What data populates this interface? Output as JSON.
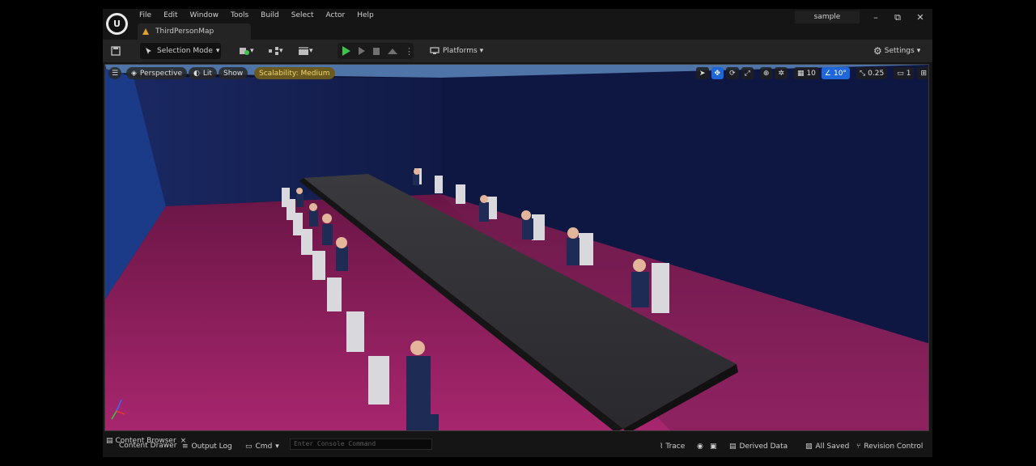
{
  "menu": [
    "File",
    "Edit",
    "Window",
    "Tools",
    "Build",
    "Select",
    "Actor",
    "Help"
  ],
  "tab": {
    "title": "ThirdPersonMap"
  },
  "project": "sample",
  "window_controls": {
    "minimize": "–",
    "restore": "⧉",
    "close": "✕"
  },
  "toolbar": {
    "selection_mode": "Selection Mode",
    "platforms": "Platforms",
    "settings": "Settings",
    "chevron": "▾"
  },
  "viewport": {
    "perspective": "Perspective",
    "lit": "Lit",
    "show": "Show",
    "scalability": "Scalability: Medium",
    "grid_snap": "10",
    "rotation_snap": "10°",
    "scale_snap": "0.25",
    "camera_speed": "1"
  },
  "status": {
    "content_browser_tab": "Content Browser",
    "content_drawer": "Content Drawer",
    "close": "×",
    "output_log": "Output Log",
    "cmd": "Cmd",
    "console_placeholder": "Enter Console Command",
    "trace": "Trace",
    "derived_data": "Derived Data",
    "all_saved": "All Saved",
    "revision_control": "Revision Control"
  },
  "colors": {
    "accent_blue": "#1f67d8",
    "play_green": "#3fc34b",
    "scalability": "#6b5a20"
  }
}
